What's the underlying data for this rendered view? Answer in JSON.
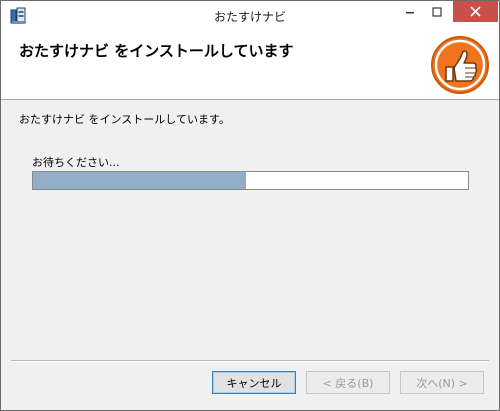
{
  "window": {
    "title": "おたすけナビ"
  },
  "header": {
    "title": "おたすけナビ をインストールしています"
  },
  "body": {
    "status_text": "おたすけナビ をインストールしています。",
    "wait_text": "お待ちください...",
    "progress_fraction": 0.49
  },
  "buttons": {
    "cancel": "キャンセル",
    "back": "< 戻る(B)",
    "next": "次へ(N) >"
  },
  "colors": {
    "progress_fill": "#92adc8",
    "close_button": "#c7504a",
    "logo_orange": "#f0741e"
  },
  "icons": {
    "app": "installer-icon",
    "logo": "thumbs-up-logo-icon",
    "minimize": "minimize-icon",
    "maximize": "maximize-icon",
    "close": "close-icon"
  }
}
